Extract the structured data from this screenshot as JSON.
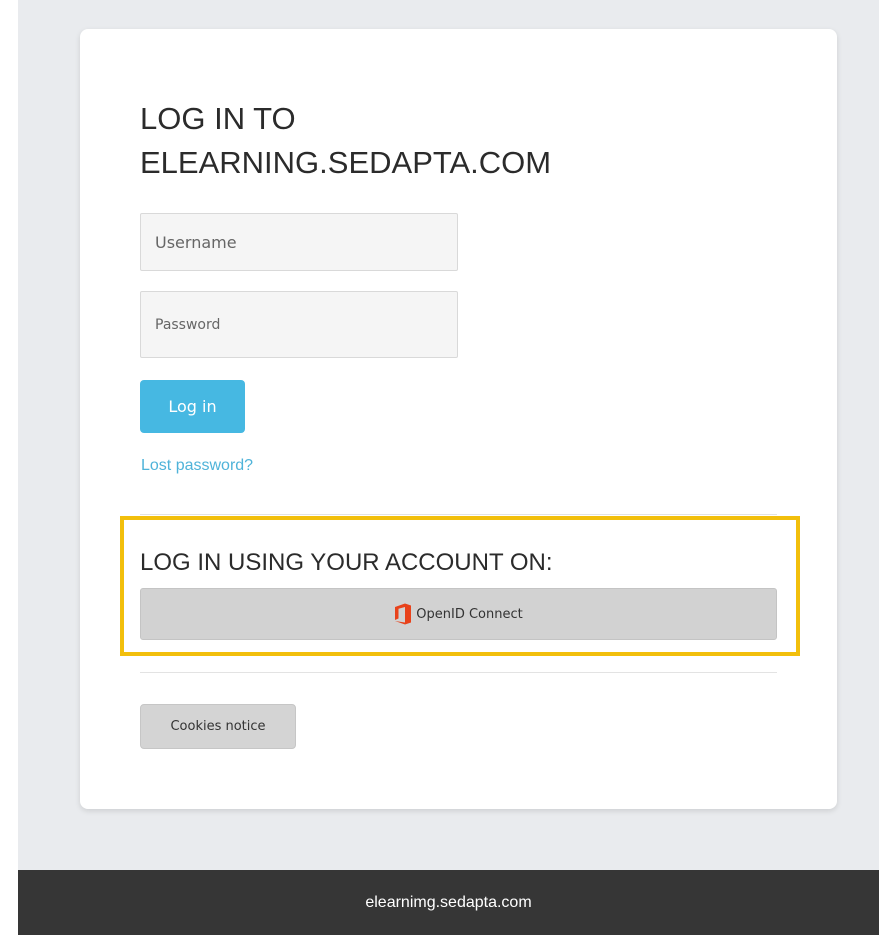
{
  "login": {
    "title_line1": "LOG IN TO",
    "title_line2": "ELEARNING.SEDAPTA.COM",
    "username_placeholder": "Username",
    "password_placeholder": "Password",
    "login_button": "Log in",
    "lost_password": "Lost password?"
  },
  "sso": {
    "heading": "LOG IN USING YOUR ACCOUNT ON:",
    "provider_label": "OpenID Connect",
    "provider_icon": "office-icon",
    "highlight_color": "#f2bf0c"
  },
  "cookies": {
    "button_label": "Cookies notice"
  },
  "footer": {
    "text": "elearnimg.sedapta.com"
  },
  "colors": {
    "primary": "#46b8e2",
    "link": "#4fb3d9",
    "footer_bg": "#363636"
  }
}
